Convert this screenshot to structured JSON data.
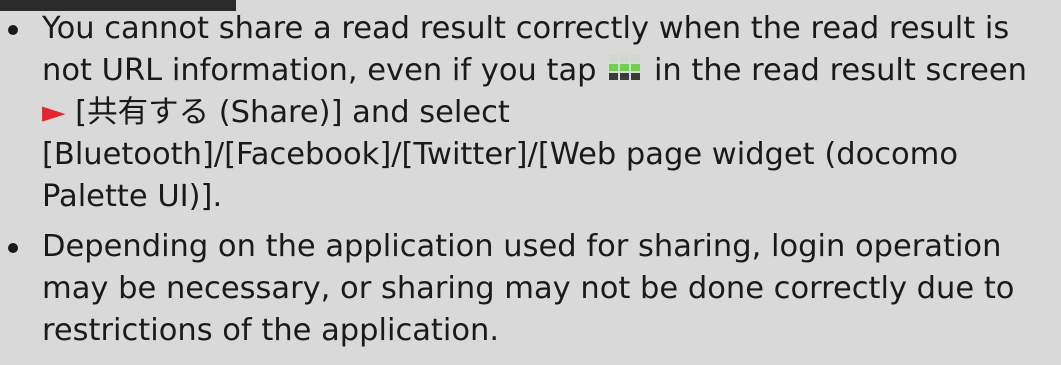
{
  "bullets": [
    {
      "parts": {
        "p1": "You cannot share a read result correctly when the read result is not URL information, even if you tap",
        "p2": "in the read result screen",
        "arrow": "►",
        "p3": "[共有する (Share)] and select [Bluetooth]/[Facebook]/[Twitter]/[Web page widget (docomo Palette UI)]."
      },
      "icon": "menu-grid-icon"
    },
    {
      "text": "Depending on the application used for sharing, login operation may be necessary, or sharing may not be done correctly due to restrictions of the application."
    }
  ],
  "colors": {
    "panel_background": "#d9d9d9",
    "header_tab": "#2b2b2b",
    "arrow": "#e0262e",
    "text": "#1a1a1a"
  }
}
